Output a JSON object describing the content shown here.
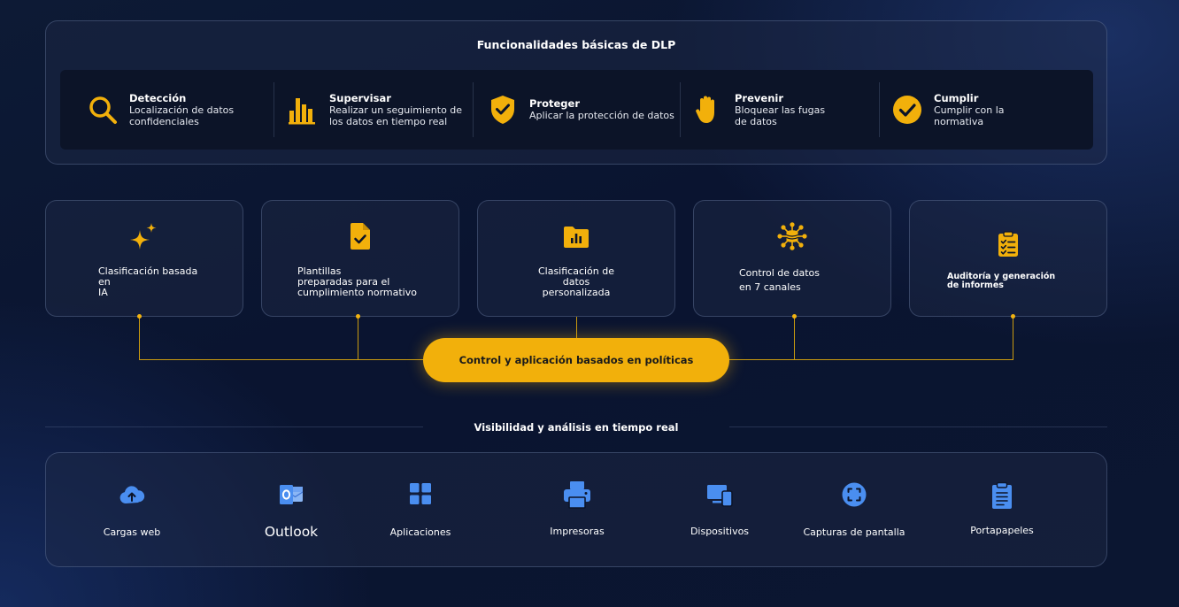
{
  "header": {
    "title": "Funcionalidades básicas de DLP"
  },
  "features": [
    {
      "title": "Detección",
      "description": "Localización de datos\nconfidenciales",
      "icon": "search-icon"
    },
    {
      "title": "Supervisar",
      "description": "Realizar un seguimiento de\nlos datos en tiempo real",
      "icon": "bar-chart-icon"
    },
    {
      "title": "Proteger",
      "description": "Aplicar la protección de datos",
      "icon": "shield-check-icon"
    },
    {
      "title": "Prevenir",
      "description": "Bloquear las fugas\nde datos",
      "icon": "hand-stop-icon"
    },
    {
      "title": "Cumplir",
      "description": "Cumplir con la\nnormativa",
      "icon": "check-circle-icon"
    }
  ],
  "capabilities": [
    {
      "label": "Clasificación basada\nen\nIA",
      "icon": "sparkles-icon"
    },
    {
      "label": "Plantillas\npreparadas para el\ncumplimiento normativo",
      "icon": "document-check-icon"
    },
    {
      "label": "Clasificación de\ndatos\npersonalizada",
      "icon": "folder-chart-icon"
    },
    {
      "label": "Control de datos\nen 7 canales",
      "icon": "network-database-icon"
    },
    {
      "label": "Auditoría y generación\nde informes",
      "icon": "clipboard-checklist-icon"
    }
  ],
  "policy": {
    "label": "Control y aplicación basados en políticas"
  },
  "visibility": {
    "title": "Visibilidad y análisis en tiempo real"
  },
  "channels": [
    {
      "label": "Cargas web",
      "icon": "cloud-upload-icon"
    },
    {
      "label": "Outlook",
      "icon": "outlook-icon"
    },
    {
      "label": "Aplicaciones",
      "icon": "apps-grid-icon"
    },
    {
      "label": "Impresoras",
      "icon": "printer-icon"
    },
    {
      "label": "Dispositivos",
      "icon": "devices-icon"
    },
    {
      "label": "Capturas de pantalla",
      "icon": "screenshot-icon"
    },
    {
      "label": "Portapapeles",
      "icon": "clipboard-icon"
    }
  ],
  "colors": {
    "accent": "#f2b00b",
    "channel_icon": "#4a8ef0",
    "background": "#0b1631"
  }
}
